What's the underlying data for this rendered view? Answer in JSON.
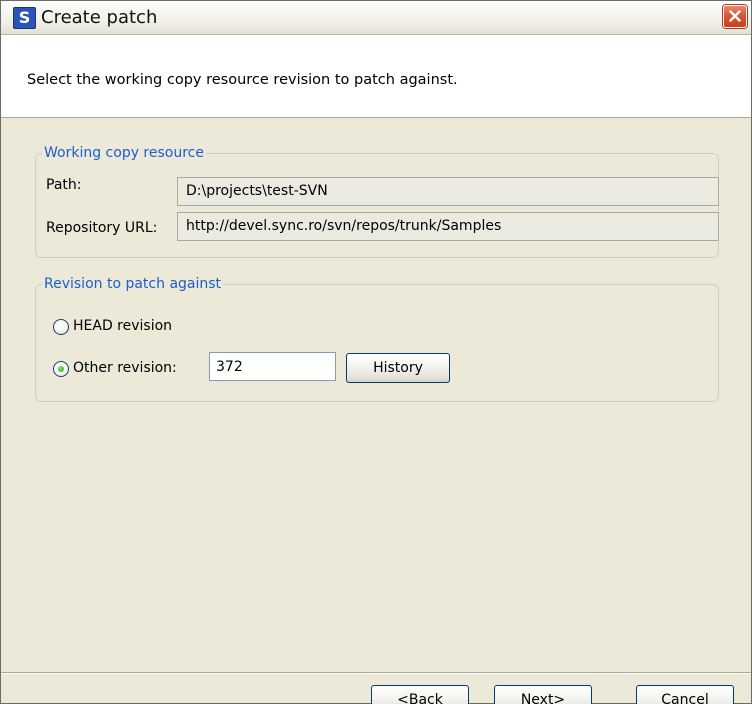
{
  "window": {
    "title": "Create patch",
    "app_icon": "S"
  },
  "banner": {
    "text": "Select the working copy resource revision to patch against."
  },
  "working_copy": {
    "legend": "Working copy resource",
    "path_label": "Path:",
    "path_value": "D:\\projects\\test-SVN",
    "url_label": "Repository URL:",
    "url_value": "http://devel.sync.ro/svn/repos/trunk/Samples"
  },
  "revision": {
    "legend": "Revision to patch against",
    "head_label": "HEAD revision",
    "other_label": "Other revision:",
    "other_value": "372",
    "selected": "other",
    "history_label": "History"
  },
  "buttons": {
    "back": "<Back",
    "next": "Next>",
    "cancel": "Cancel"
  },
  "icons": {
    "app": "svn-logo-icon",
    "close": "close-icon"
  },
  "colors": {
    "legend": "#1c5dd0",
    "dialog_bg": "#ece9d8",
    "close_button": "#d8553a",
    "radio_dot": "#2fa21b"
  }
}
